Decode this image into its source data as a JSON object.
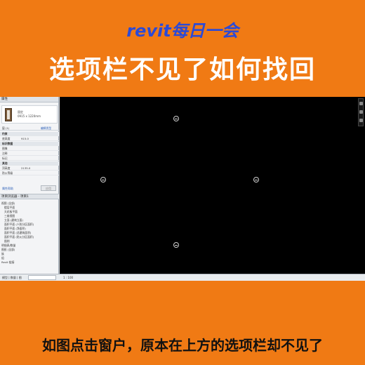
{
  "header": {
    "series_title": "revit每日一会",
    "main_title": "选项栏不见了如何找回"
  },
  "properties_panel": {
    "title": "属性",
    "type_name": "固定",
    "type_size": "0915 x 1220mm",
    "filter_label": "窗 (1)",
    "edit_type_label": "编辑类型",
    "rows": [
      {
        "label": "约束",
        "value": "",
        "section": true
      },
      {
        "label": "底高度",
        "value": "915.0",
        "section": false
      },
      {
        "label": "标识数据",
        "value": "",
        "section": true
      },
      {
        "label": "图像",
        "value": "",
        "section": false
      },
      {
        "label": "注释",
        "value": "",
        "section": false
      },
      {
        "label": "标记",
        "value": "",
        "section": false
      },
      {
        "label": "其他",
        "value": "",
        "section": true
      },
      {
        "label": "顶高度",
        "value": "2135.0",
        "section": false
      },
      {
        "label": "防火等级",
        "value": "",
        "section": false
      }
    ],
    "help_link": "属性帮助",
    "apply_label": "应用"
  },
  "project_browser": {
    "title": "项目浏览器 - 项目1",
    "items": [
      "视图 (全部)",
      "楼层平面",
      "天花板平面",
      "三维视图",
      "立面 (建筑立面)",
      "面积平面 (人防分区面积)",
      "面积平面 (净面积)",
      "面积平面 (总建筑面积)",
      "面积平面 (防火分区面积)",
      "图例",
      "明细表/数量",
      "图纸 (全部)",
      "族",
      "组",
      "Revit 链接"
    ]
  },
  "status_bar": {
    "left_text": "模型 | 数量 | 图",
    "scale_text": "1 : 100"
  },
  "caption": "如图点击窗户，原本在上方的选项栏却不见了"
}
